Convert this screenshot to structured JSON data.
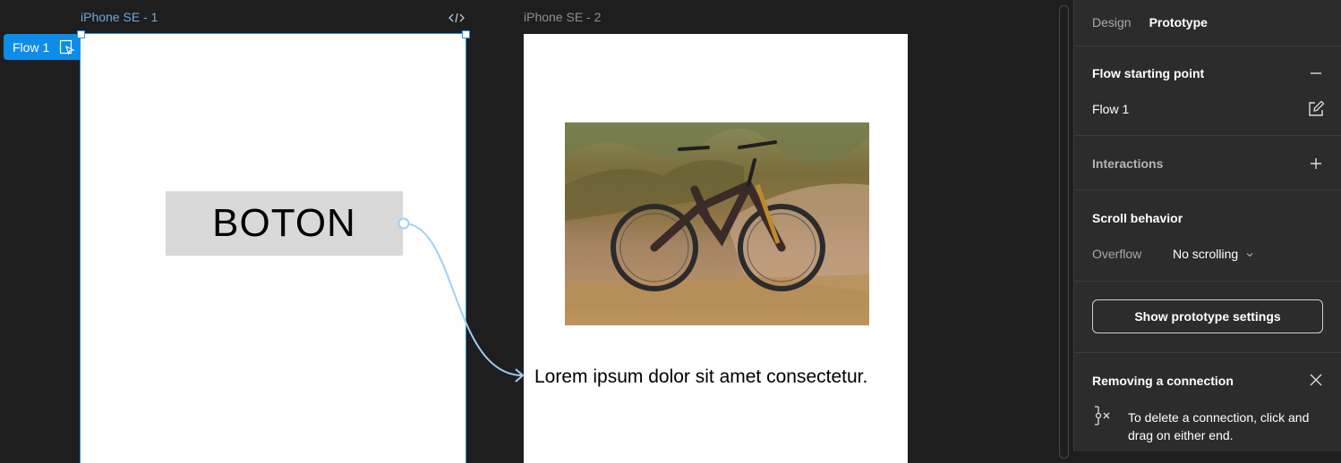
{
  "canvas": {
    "frame1_label": "iPhone SE - 1",
    "frame2_label": "iPhone SE - 2",
    "flow_tag": "Flow 1",
    "button_text": "BOTON",
    "lorem": "Lorem ipsum dolor sit amet consectetur."
  },
  "panel": {
    "tabs": [
      "Design",
      "Prototype"
    ],
    "flow_heading": "Flow starting point",
    "flow_name": "Flow 1",
    "interactions_heading": "Interactions",
    "scroll_heading": "Scroll behavior",
    "overflow_label": "Overflow",
    "overflow_value": "No scrolling",
    "show_settings_button": "Show prototype settings",
    "removing_heading": "Removing a connection",
    "removing_text": "To delete a connection, click and drag on either end."
  },
  "colors": {
    "selection_blue": "#2f8fe6",
    "flow_tag_blue": "#0d8ce8",
    "connector": "#9fd0f7"
  },
  "icons": [
    "code-icon",
    "play-frame-icon",
    "minus-icon",
    "edit-icon",
    "plus-icon",
    "chevron-down-icon",
    "close-icon",
    "disconnect-icon"
  ]
}
